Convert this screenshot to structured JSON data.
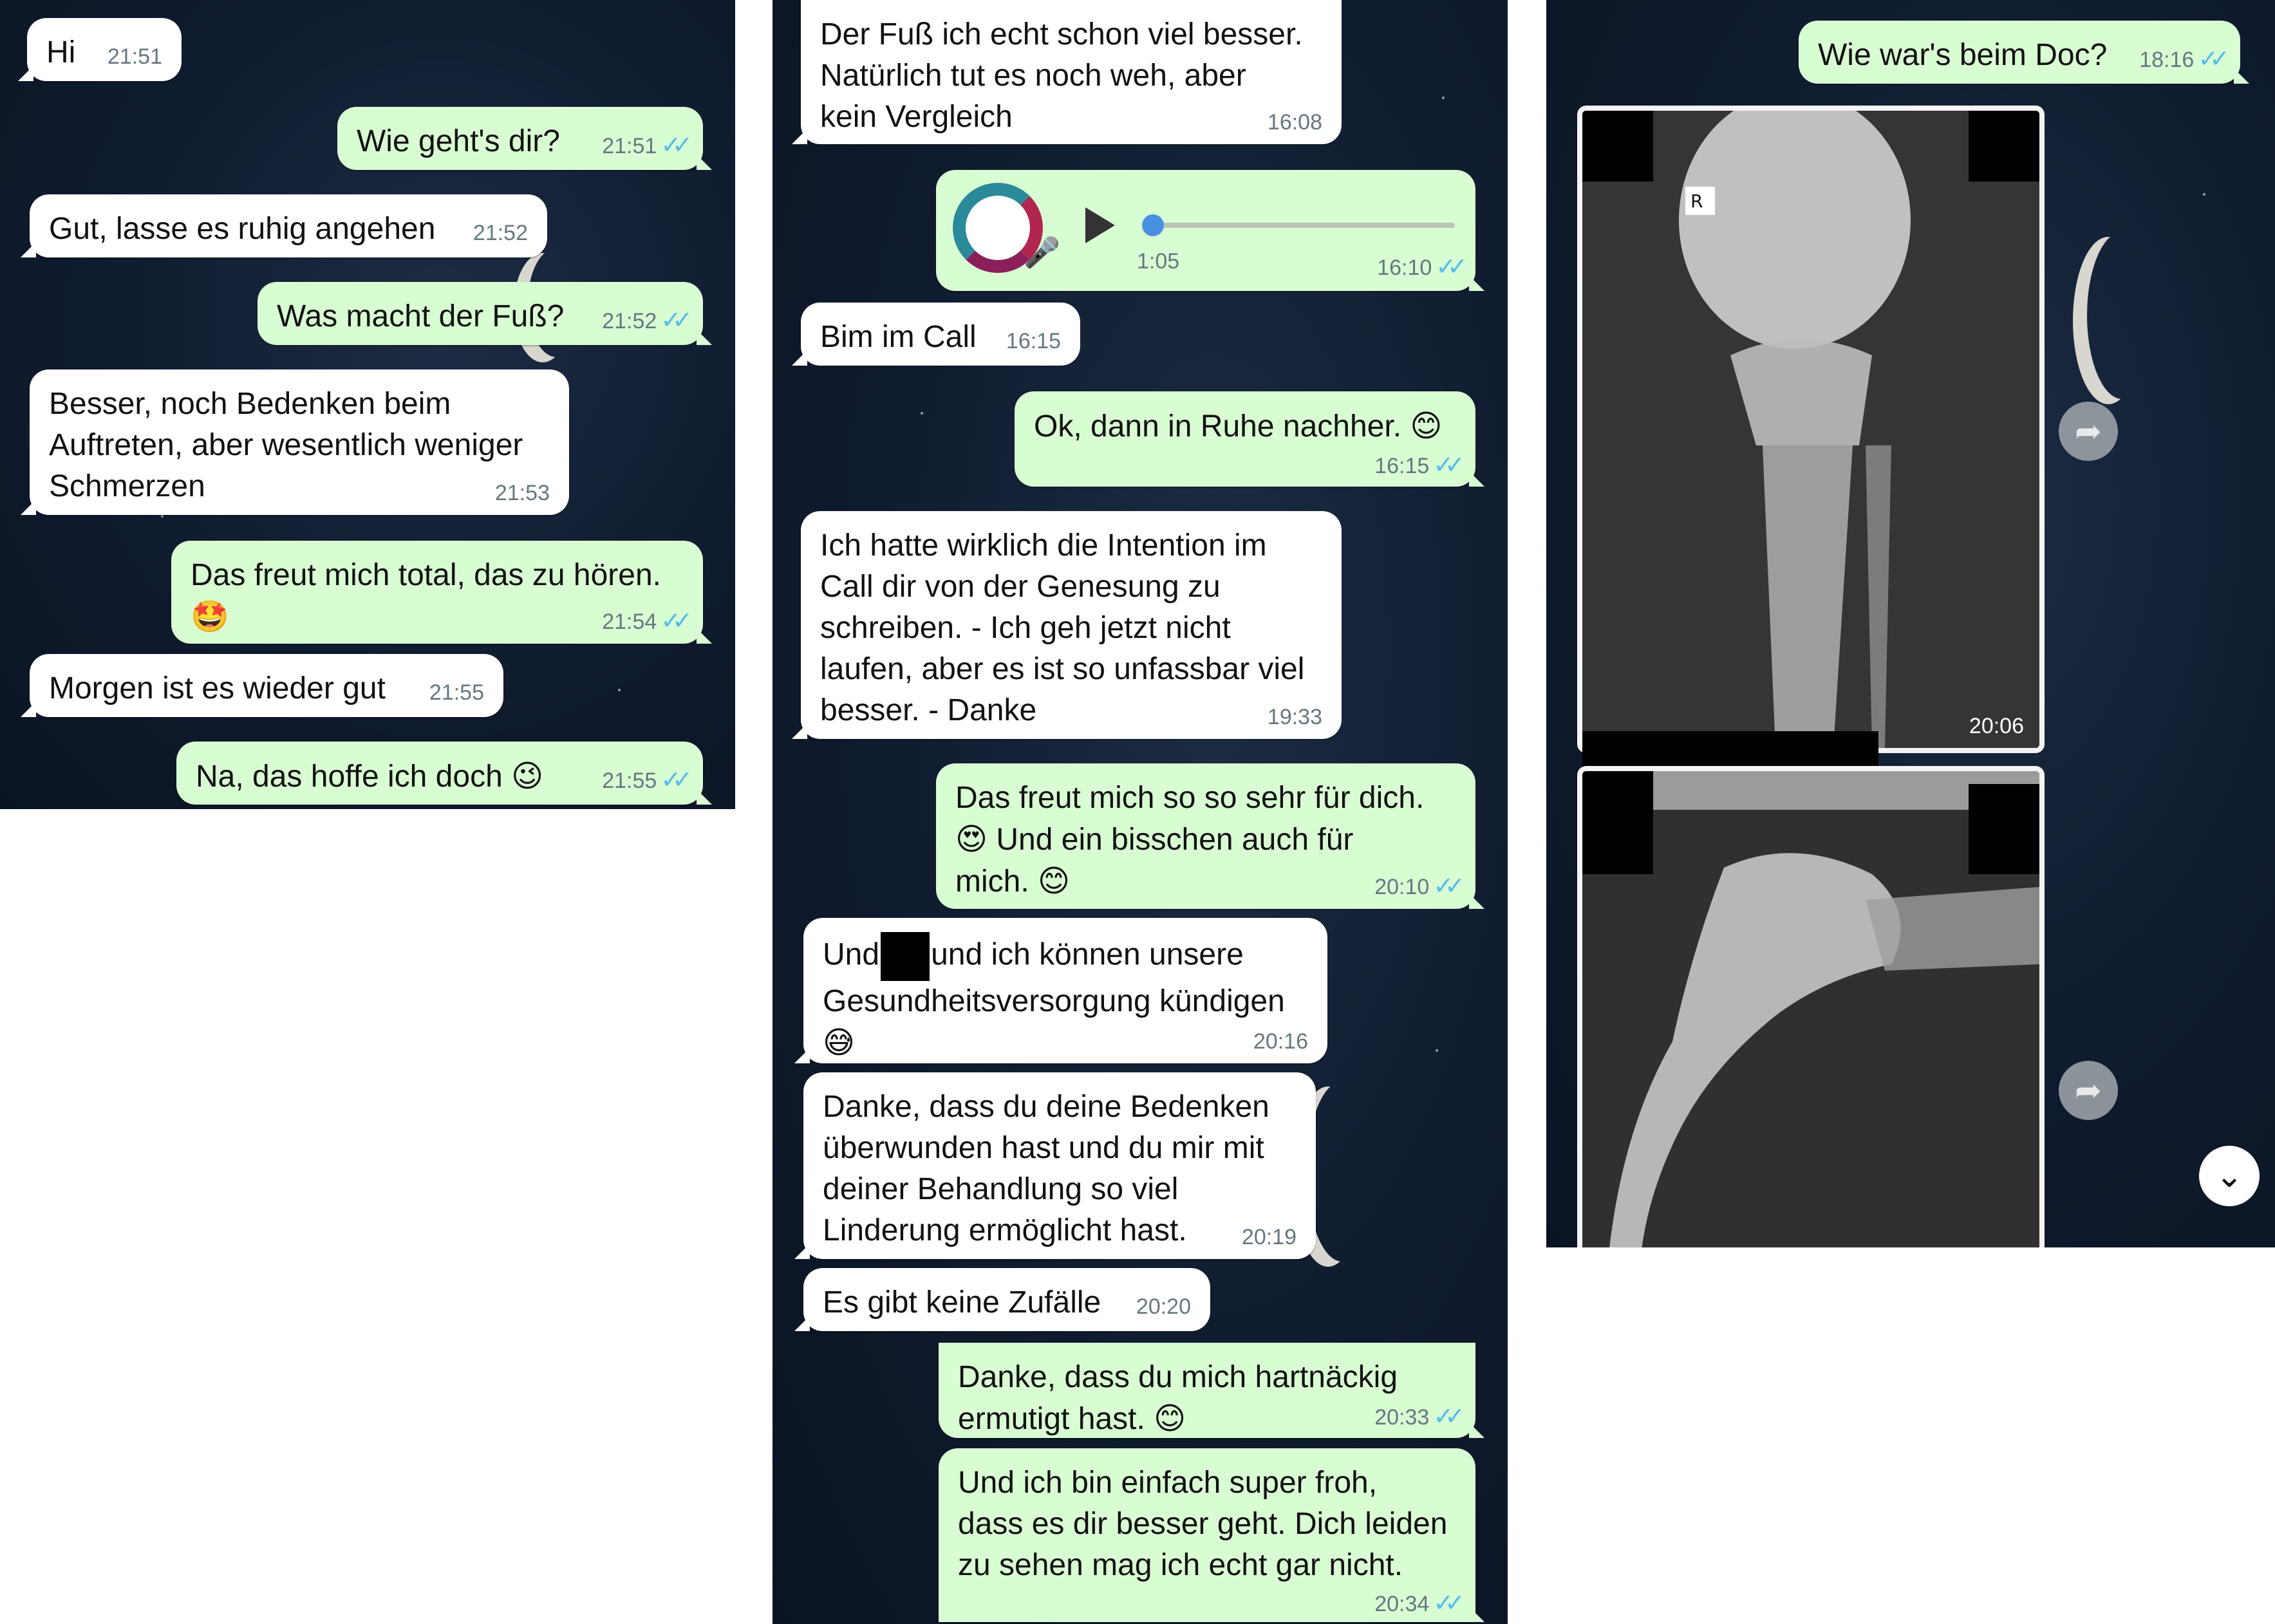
{
  "left": {
    "messages": [
      {
        "dir": "in",
        "text": "Hi",
        "time": "21:51"
      },
      {
        "dir": "out",
        "text": "Wie geht's dir?",
        "time": "21:51"
      },
      {
        "dir": "in",
        "text": "Gut, lasse es ruhig angehen",
        "time": "21:52"
      },
      {
        "dir": "out",
        "text": "Was macht der Fuß?",
        "time": "21:52"
      },
      {
        "dir": "in",
        "text": "Besser, noch Bedenken beim\nAuftreten, aber wesentlich weniger\nSchmerzen",
        "time": "21:53"
      },
      {
        "dir": "out",
        "text": "Das freut mich total, das zu hören.",
        "emoji": "🤩",
        "time": "21:54"
      },
      {
        "dir": "in",
        "text": "Morgen ist es wieder gut",
        "time": "21:55"
      },
      {
        "dir": "out",
        "text": "Na, das hoffe ich doch",
        "emoji": "😉",
        "time": "21:55"
      }
    ]
  },
  "middle": {
    "msg1": {
      "text": "Der Fuß ich echt schon viel besser.\nNatürlich tut es noch weh, aber\nkein Vergleich",
      "time": "16:08"
    },
    "voice": {
      "duration": "1:05",
      "time": "16:10",
      "progress": 0
    },
    "msg3": {
      "text": "Bim im Call",
      "time": "16:15"
    },
    "msg4": {
      "text": "Ok, dann in Ruhe nachher.",
      "emoji": "😊",
      "time": "16:15"
    },
    "msg5": {
      "text": "Ich hatte wirklich die Intention im\nCall dir von der Genesung zu\nschreiben. - Ich geh jetzt nicht\nlaufen, aber es ist so unfassbar viel\nbesser. - Danke",
      "time": "19:33"
    },
    "msg6": {
      "line1": "Das freut mich so so sehr für dich.",
      "line2": "Und ein bisschen auch für",
      "line3": "mich.",
      "emoji_a": "😍",
      "emoji_b": "😊",
      "time": "20:10"
    },
    "msg7": {
      "pre": "Und",
      "post": "und ich können unsere",
      "line2": "Gesundheitsversorgung kündigen",
      "emoji": "😅",
      "time": "20:16"
    },
    "msg8": {
      "text": "Danke, dass du deine Bedenken\nüberwunden hast und du mir mit\ndeiner Behandlung so viel\nLinderung ermöglicht hast.",
      "time": "20:19"
    },
    "msg9": {
      "text": "Es gibt keine Zufälle",
      "time": "20:20"
    },
    "msg10": {
      "text": "Danke, dass du mich hartnäckig\nermutigt hast.",
      "emoji": "😊",
      "time": "20:33"
    },
    "msg11": {
      "text": "Und ich bin einfach super froh,\ndass es dir besser geht. Dich leiden\nzu sehen mag ich echt gar nicht.",
      "time": "20:34"
    }
  },
  "right": {
    "msg1": {
      "text": "Wie war's beim Doc?",
      "time": "18:16"
    },
    "image1": {
      "time": "20:06",
      "marker": "R"
    },
    "icons": {
      "forward": "forward-icon",
      "scroll_down": "chevron-down-icon"
    }
  },
  "ticks": "✓✓",
  "colors": {
    "incoming": "#ffffff",
    "outgoing": "#d9fdd3",
    "ticks": "#53bdeb",
    "background": "#0f1b2e"
  }
}
